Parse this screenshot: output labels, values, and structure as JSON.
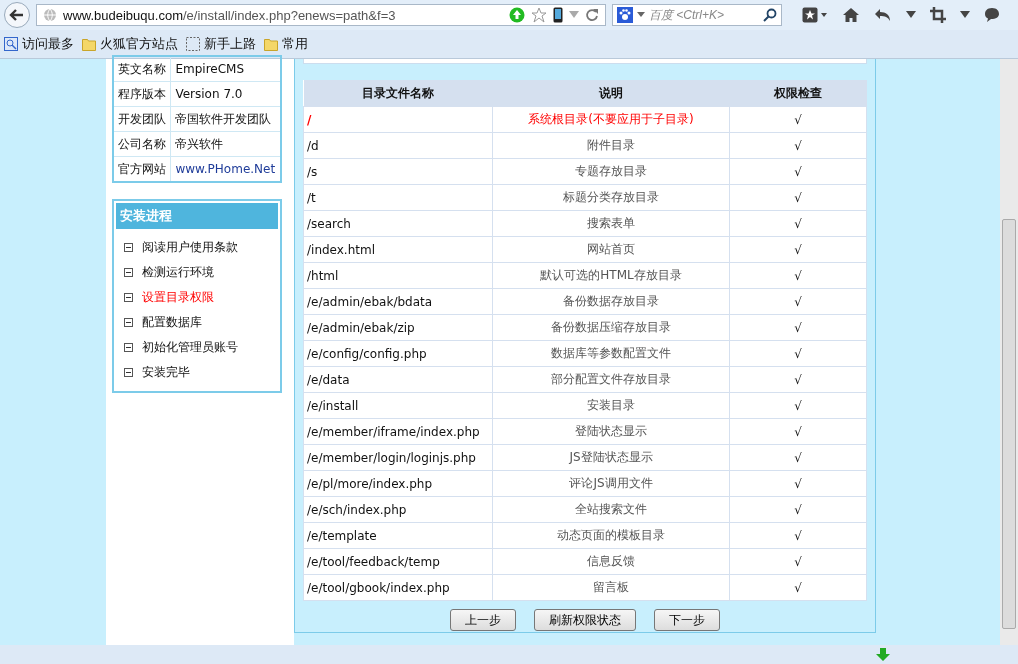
{
  "browser": {
    "url_host": "www.budeibuqu.com",
    "url_path": "/e/install/index.php?enews=path&f=3",
    "search_placeholder": "百度 <Ctrl+K>"
  },
  "bookmarks": [
    {
      "label": "访问最多",
      "kind": "search"
    },
    {
      "label": "火狐官方站点",
      "kind": "folder"
    },
    {
      "label": "新手上路",
      "kind": "page"
    },
    {
      "label": "常用",
      "kind": "folder"
    }
  ],
  "info": [
    {
      "label": "英文名称",
      "value": "EmpireCMS",
      "link": false
    },
    {
      "label": "程序版本",
      "value": "Version 7.0",
      "link": false
    },
    {
      "label": "开发团队",
      "value": "帝国软件开发团队",
      "link": false
    },
    {
      "label": "公司名称",
      "value": "帝兴软件",
      "link": false
    },
    {
      "label": "官方网站",
      "value": "www.PHome.Net",
      "link": true
    }
  ],
  "progress": {
    "title": "安装进程",
    "steps": [
      {
        "label": "阅读用户使用条款",
        "selected": false
      },
      {
        "label": "检测运行环境",
        "selected": false
      },
      {
        "label": "设置目录权限",
        "selected": true
      },
      {
        "label": "配置数据库",
        "selected": false
      },
      {
        "label": "初始化管理员账号",
        "selected": false
      },
      {
        "label": "安装完毕",
        "selected": false
      }
    ]
  },
  "table": {
    "columns": [
      "目录文件名称",
      "说明",
      "权限检查"
    ],
    "rows": [
      {
        "path": "/",
        "note": "系统根目录(不要应用于子目录)",
        "check": "√",
        "emphasized": true
      },
      {
        "path": "/d",
        "note": "附件目录",
        "check": "√",
        "emphasized": false
      },
      {
        "path": "/s",
        "note": "专题存放目录",
        "check": "√",
        "emphasized": false
      },
      {
        "path": "/t",
        "note": "标题分类存放目录",
        "check": "√",
        "emphasized": false
      },
      {
        "path": "/search",
        "note": "搜索表单",
        "check": "√",
        "emphasized": false
      },
      {
        "path": "/index.html",
        "note": "网站首页",
        "check": "√",
        "emphasized": false
      },
      {
        "path": "/html",
        "note": "默认可选的HTML存放目录",
        "check": "√",
        "emphasized": false
      },
      {
        "path": "/e/admin/ebak/bdata",
        "note": "备份数据存放目录",
        "check": "√",
        "emphasized": false
      },
      {
        "path": "/e/admin/ebak/zip",
        "note": "备份数据压缩存放目录",
        "check": "√",
        "emphasized": false
      },
      {
        "path": "/e/config/config.php",
        "note": "数据库等参数配置文件",
        "check": "√",
        "emphasized": false
      },
      {
        "path": "/e/data",
        "note": "部分配置文件存放目录",
        "check": "√",
        "emphasized": false
      },
      {
        "path": "/e/install",
        "note": "安装目录",
        "check": "√",
        "emphasized": false
      },
      {
        "path": "/e/member/iframe/index.php",
        "note": "登陆状态显示",
        "check": "√",
        "emphasized": false
      },
      {
        "path": "/e/member/login/loginjs.php",
        "note": "JS登陆状态显示",
        "check": "√",
        "emphasized": false
      },
      {
        "path": "/e/pl/more/index.php",
        "note": "评论JS调用文件",
        "check": "√",
        "emphasized": false
      },
      {
        "path": "/e/sch/index.php",
        "note": "全站搜索文件",
        "check": "√",
        "emphasized": false
      },
      {
        "path": "/e/template",
        "note": "动态页面的模板目录",
        "check": "√",
        "emphasized": false
      },
      {
        "path": "/e/tool/feedback/temp",
        "note": "信息反馈",
        "check": "√",
        "emphasized": false
      },
      {
        "path": "/e/tool/gbook/index.php",
        "note": "留言板",
        "check": "√",
        "emphasized": false
      }
    ]
  },
  "buttons": [
    "上一步",
    "刷新权限状态",
    "下一步"
  ]
}
